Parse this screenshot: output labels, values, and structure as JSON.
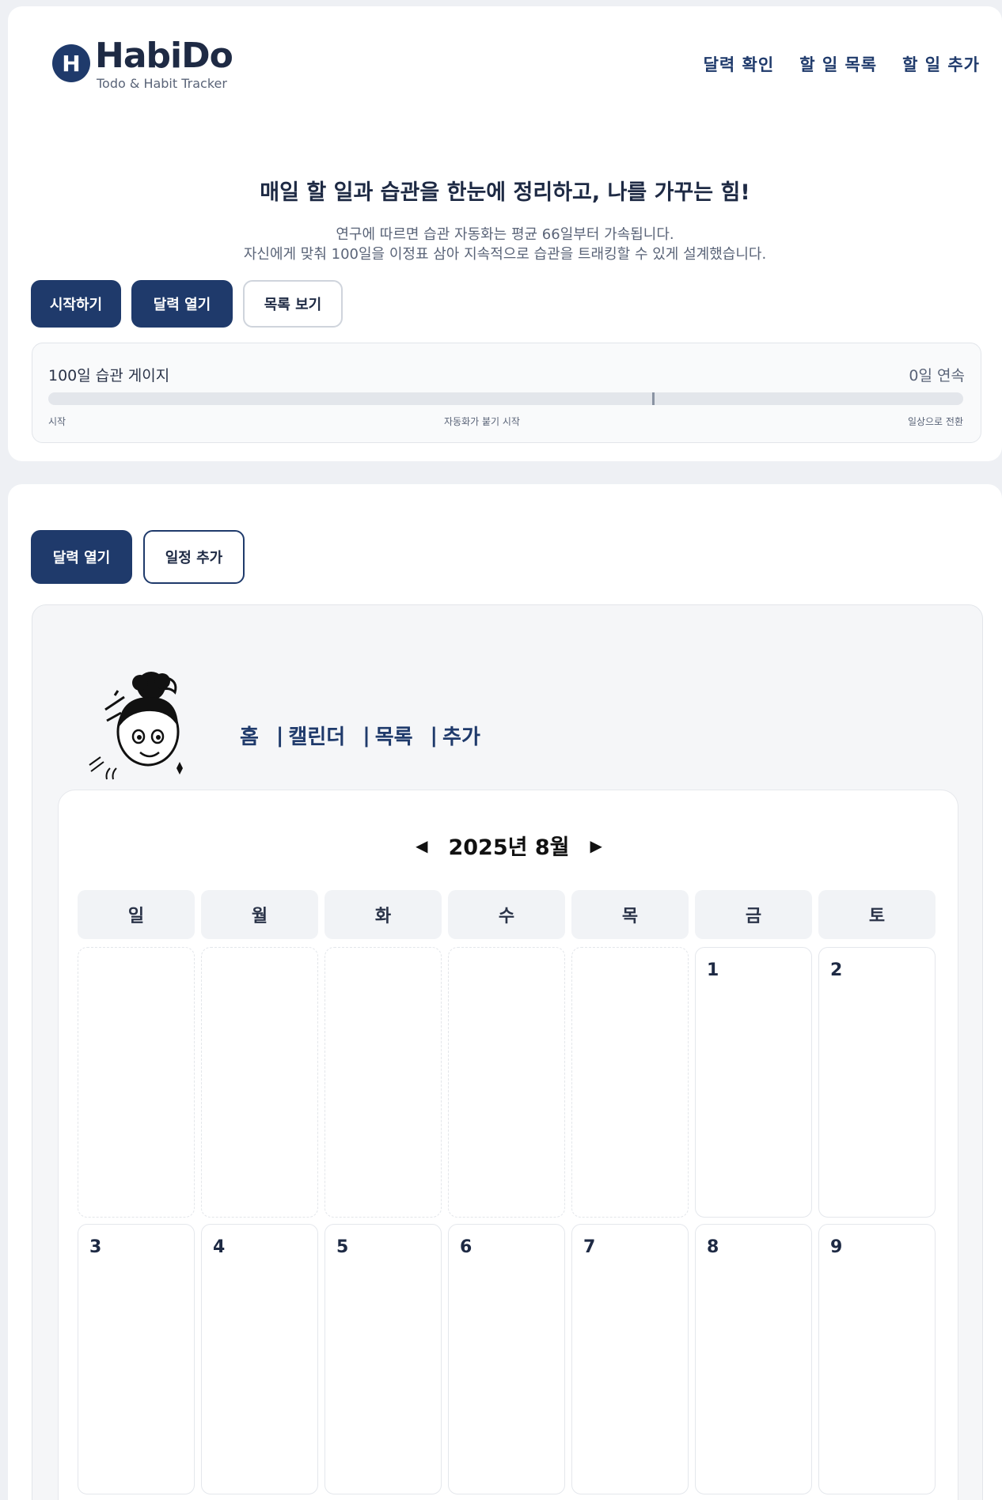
{
  "brand": {
    "mark": "H",
    "name": "HabiDo",
    "tagline": "Todo & Habit Tracker"
  },
  "topnav": [
    {
      "label": "달력 확인"
    },
    {
      "label": "할 일 목록"
    },
    {
      "label": "할 일 추가"
    }
  ],
  "hero": {
    "title": "매일 할 일과 습관을 한눈에 정리하고, 나를 가꾸는 힘!",
    "desc_line1": "연구에 따르면 습관 자동화는 평균 66일부터 가속됩니다.",
    "desc_line2": "자신에게 맞춰 100일을 이정표 삼아 지속적으로 습관을 트래킹할 수 있게 설계했습니다.",
    "buttons": {
      "start": "시작하기",
      "open_calendar": "달력 열기",
      "view_list": "목록 보기"
    }
  },
  "gauge": {
    "title": "100일 습관 게이지",
    "streak": "0일 연속",
    "progress": 0,
    "marker_day": 66,
    "total_days": 100,
    "labels": {
      "start": "시작",
      "middle": "자동화가 붙기 시작",
      "end": "일상으로 전환"
    }
  },
  "calendar_section": {
    "buttons": {
      "open_calendar": "달력 열기",
      "add_event": "일정 추가"
    },
    "subnav": [
      {
        "label": "홈"
      },
      {
        "label": "캘린더"
      },
      {
        "label": "목록"
      },
      {
        "label": "추가"
      }
    ],
    "separator": "|",
    "prev_arrow": "◀",
    "next_arrow": "▶",
    "month_title": "2025년 8월",
    "weekdays": [
      "일",
      "월",
      "화",
      "수",
      "목",
      "금",
      "토"
    ],
    "leading_blanks": 5,
    "visible_days": [
      1,
      2,
      3,
      4,
      5,
      6,
      7,
      8,
      9
    ]
  },
  "colors": {
    "primary": "#1f3a6b",
    "background": "#eef0f4"
  }
}
